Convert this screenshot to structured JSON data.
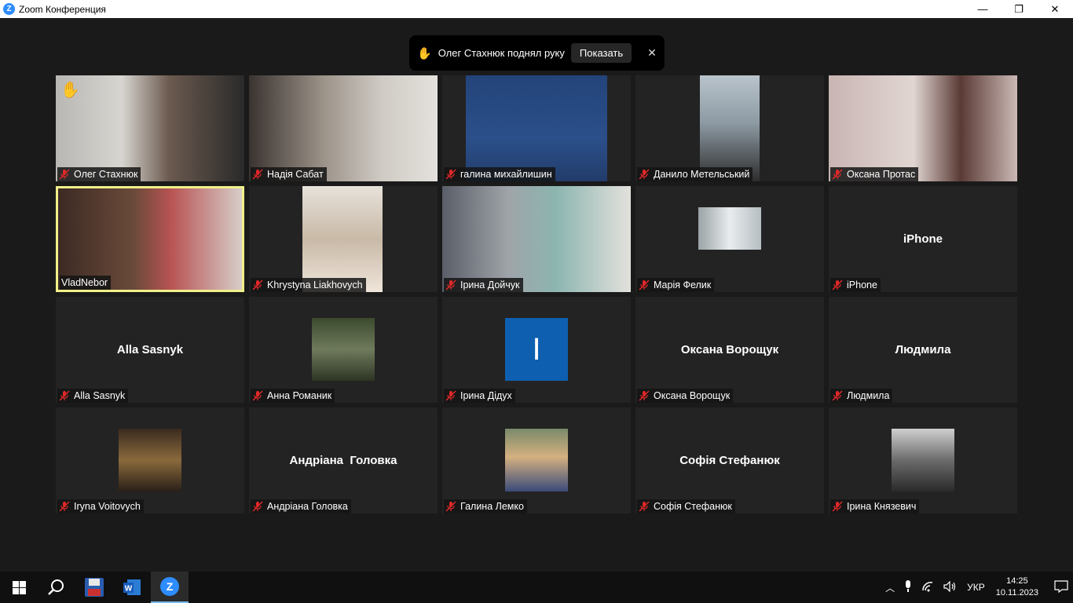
{
  "window": {
    "title": "Zoom Конференция",
    "minimize": "—",
    "maximize": "❐",
    "close": "✕"
  },
  "notification": {
    "icon": "raised-hand",
    "text": "Олег Стахнюк поднял руку",
    "button": "Показать",
    "close": "✕"
  },
  "participants": [
    {
      "name": "Олег Стахнюк",
      "video": true,
      "hand_raised": true,
      "active": false
    },
    {
      "name": "Надія Сабат",
      "video": true,
      "active": false
    },
    {
      "name": "галина михайлишин",
      "video": true,
      "active": false
    },
    {
      "name": "Данило Метельський",
      "video": true,
      "active": false
    },
    {
      "name": "Оксана Протас",
      "video": true,
      "active": false
    },
    {
      "name": "VladNebor",
      "video": true,
      "active": true
    },
    {
      "name": "Khrystyna Liakhovych",
      "video": true,
      "active": false
    },
    {
      "name": "Ірина Дойчук",
      "video": true,
      "active": false
    },
    {
      "name": "Марія Фелик",
      "video": true,
      "active": false
    },
    {
      "name": "iPhone",
      "video": false,
      "display": "iPhone",
      "active": false
    },
    {
      "name": "Alla Sasnyk",
      "video": false,
      "display": "Alla Sasnyk",
      "active": false
    },
    {
      "name": "Анна Романик",
      "video": true,
      "active": false
    },
    {
      "name": "Ірина Дідух",
      "video": false,
      "initial": "I",
      "active": false
    },
    {
      "name": "Оксана Ворощук",
      "video": false,
      "display": "Оксана Ворощук",
      "active": false
    },
    {
      "name": "Людмила",
      "video": false,
      "display": "Людмила",
      "active": false
    },
    {
      "name": "Iryna Voitovych",
      "video": true,
      "active": false
    },
    {
      "name": "Андріана Головка",
      "video": false,
      "display": "Андріана  Головка",
      "active": false
    },
    {
      "name": "Галина Лемко",
      "video": true,
      "active": false
    },
    {
      "name": "Софія Стефанюк",
      "video": false,
      "display": "Софія Стефанюк",
      "active": false
    },
    {
      "name": "Ірина Князевич",
      "video": true,
      "active": false
    }
  ],
  "taskbar": {
    "items": [
      "windows-start",
      "search",
      "save-app",
      "word",
      "zoom"
    ],
    "active": "zoom",
    "tray": {
      "language": "УКР",
      "time": "14:25",
      "date": "10.11.2023"
    }
  }
}
